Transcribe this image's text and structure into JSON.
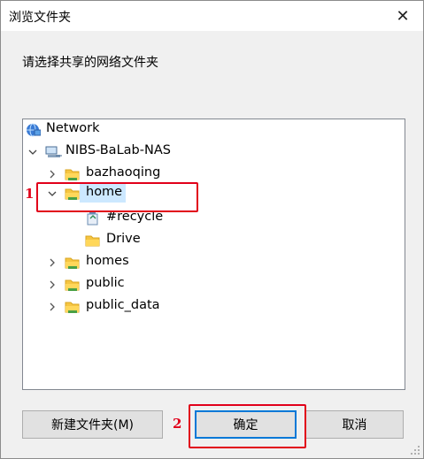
{
  "window": {
    "title": "浏览文件夹",
    "close_glyph": "✕"
  },
  "prompt": "请选择共享的网络文件夹",
  "tree": {
    "items": [
      {
        "label": "Network",
        "icon": "network-icon",
        "expanded": true
      },
      {
        "label": "NIBS-BaLab-NAS",
        "icon": "computer-icon",
        "expanded": true
      },
      {
        "label": "bazhaoqing",
        "icon": "shared-folder-icon",
        "expanded": false
      },
      {
        "label": "home",
        "icon": "shared-folder-icon",
        "expanded": true,
        "selected": true
      },
      {
        "label": "#recycle",
        "icon": "recycle-folder-icon"
      },
      {
        "label": "Drive",
        "icon": "folder-icon"
      },
      {
        "label": "homes",
        "icon": "shared-folder-icon",
        "expanded": false
      },
      {
        "label": "public",
        "icon": "shared-folder-icon",
        "expanded": false
      },
      {
        "label": "public_data",
        "icon": "shared-folder-icon",
        "expanded": false
      }
    ]
  },
  "annotations": {
    "step1": "1",
    "step2": "2",
    "color": "#e1001a"
  },
  "buttons": {
    "new_folder": "新建文件夹(M)",
    "ok": "确定",
    "cancel": "取消"
  },
  "colors": {
    "selection": "#cce8ff",
    "accent": "#0078d7"
  }
}
